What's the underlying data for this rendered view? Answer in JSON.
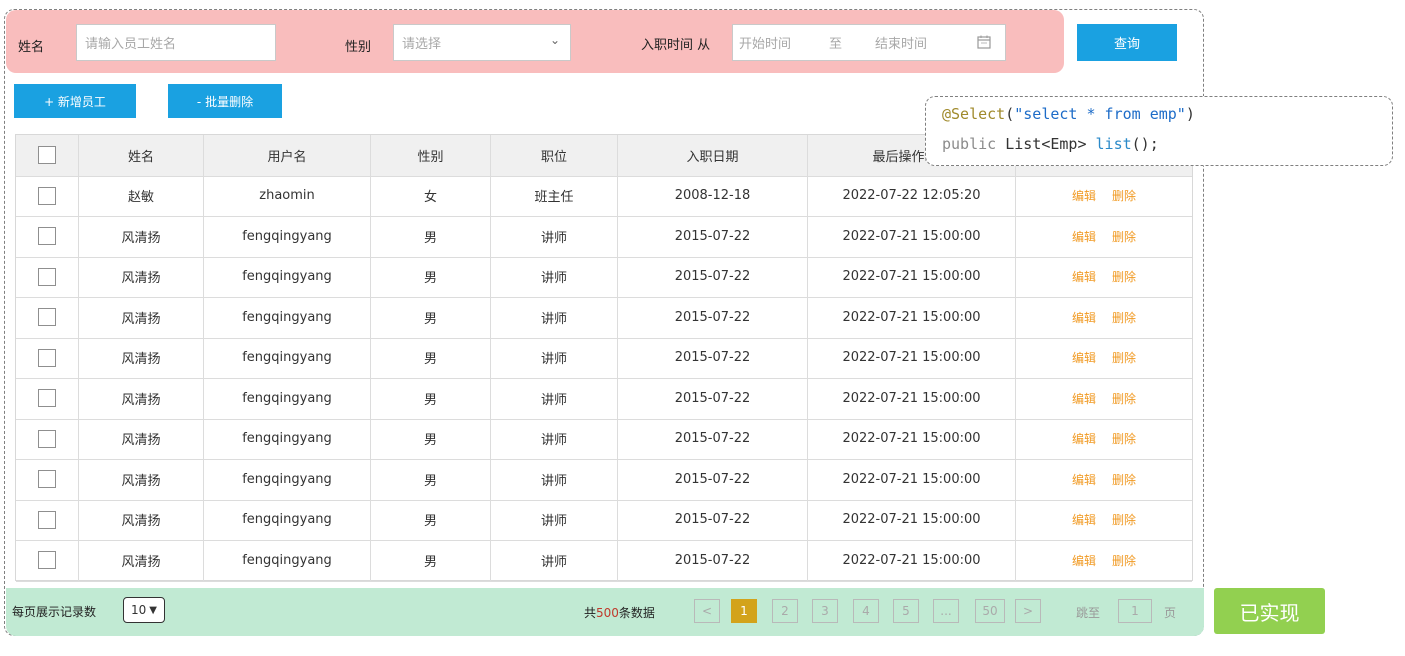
{
  "search": {
    "name_label": "姓名",
    "name_placeholder": "请输入员工姓名",
    "gender_label": "性别",
    "gender_placeholder": "请选择",
    "date_label": "入职时间 从",
    "date_start_placeholder": "开始时间",
    "date_sep": "至",
    "date_end_placeholder": "结束时间",
    "query_button": "查询"
  },
  "toolbar": {
    "add_button": "+ 新增员工",
    "batch_delete_button": "- 批量删除"
  },
  "code": {
    "line1": {
      "annotation": "@Select",
      "open": "(",
      "string": "\"select * from emp\"",
      "close": ")"
    },
    "line2": {
      "kw": "public",
      "type": "List<Emp>",
      "method": "list",
      "tail": "();"
    }
  },
  "table": {
    "headers": [
      "姓名",
      "用户名",
      "性别",
      "职位",
      "入职日期",
      "最后操作时间",
      ""
    ],
    "actions": {
      "edit": "编辑",
      "delete": "删除"
    },
    "rows": [
      [
        "赵敏",
        "zhaomin",
        "女",
        "班主任",
        "2008-12-18",
        "2022-07-22 12:05:20"
      ],
      [
        "风清扬",
        "fengqingyang",
        "男",
        "讲师",
        "2015-07-22",
        "2022-07-21 15:00:00"
      ],
      [
        "风清扬",
        "fengqingyang",
        "男",
        "讲师",
        "2015-07-22",
        "2022-07-21 15:00:00"
      ],
      [
        "风清扬",
        "fengqingyang",
        "男",
        "讲师",
        "2015-07-22",
        "2022-07-21 15:00:00"
      ],
      [
        "风清扬",
        "fengqingyang",
        "男",
        "讲师",
        "2015-07-22",
        "2022-07-21 15:00:00"
      ],
      [
        "风清扬",
        "fengqingyang",
        "男",
        "讲师",
        "2015-07-22",
        "2022-07-21 15:00:00"
      ],
      [
        "风清扬",
        "fengqingyang",
        "男",
        "讲师",
        "2015-07-22",
        "2022-07-21 15:00:00"
      ],
      [
        "风清扬",
        "fengqingyang",
        "男",
        "讲师",
        "2015-07-22",
        "2022-07-21 15:00:00"
      ],
      [
        "风清扬",
        "fengqingyang",
        "男",
        "讲师",
        "2015-07-22",
        "2022-07-21 15:00:00"
      ],
      [
        "风清扬",
        "fengqingyang",
        "男",
        "讲师",
        "2015-07-22",
        "2022-07-21 15:00:00"
      ]
    ]
  },
  "pagination": {
    "page_size_label": "每页展示记录数",
    "page_size_value": "10",
    "total_prefix": "共",
    "total_count": "500",
    "total_suffix": "条数据",
    "prev": "<",
    "pages": [
      "1",
      "2",
      "3",
      "4",
      "5",
      "...",
      "50"
    ],
    "current_page": "1",
    "next": ">",
    "jump_label": "跳至",
    "jump_value": "1",
    "page_unit": "页"
  },
  "status_badge": "已实现",
  "colors": {
    "search_bg": "#f9bdbd",
    "footer_bg": "#c1ead3",
    "button_blue": "#1aa1e1",
    "action_orange": "#f19a23",
    "active_page": "#d3a31b",
    "done_green": "#92d050"
  }
}
